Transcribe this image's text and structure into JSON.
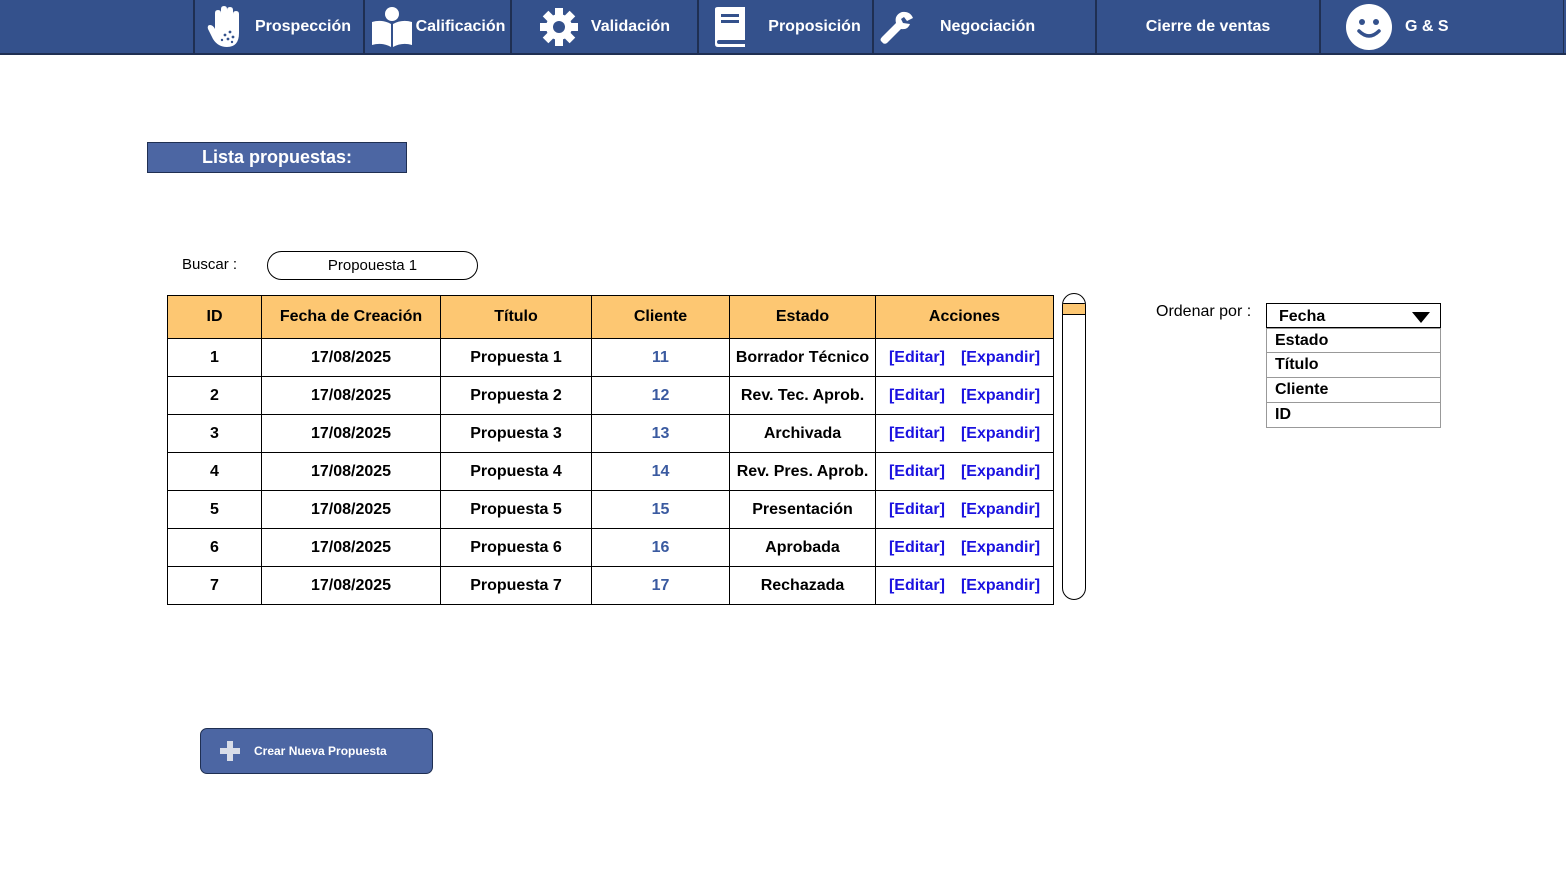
{
  "nav": {
    "items": [
      {
        "label": "Prospección",
        "icon": "hand-icon"
      },
      {
        "label": "Calificación",
        "icon": "book-person-icon"
      },
      {
        "label": "Validación",
        "icon": "gear-icon"
      },
      {
        "label": "Proposición",
        "icon": "book-icon"
      },
      {
        "label": "Negociación",
        "icon": "wrench-icon"
      },
      {
        "label": "Cierre de ventas",
        "icon": ""
      }
    ],
    "profile": {
      "label": "G & S",
      "icon": "smiley-face-icon"
    }
  },
  "page": {
    "title": "Lista propuestas:"
  },
  "search": {
    "label": "Buscar :",
    "value": "Propouesta 1"
  },
  "table": {
    "headers": [
      "ID",
      "Fecha de Creación",
      "Título",
      "Cliente",
      "Estado",
      "Acciones"
    ],
    "action_edit": "[Editar]",
    "action_expand": "[Expandir]",
    "rows": [
      {
        "id": "1",
        "date": "17/08/2025",
        "title": "Propuesta 1",
        "client": "11",
        "status": "Borrador Técnico"
      },
      {
        "id": "2",
        "date": "17/08/2025",
        "title": "Propuesta 2",
        "client": "12",
        "status": "Rev. Tec. Aprob."
      },
      {
        "id": "3",
        "date": "17/08/2025",
        "title": "Propuesta 3",
        "client": "13",
        "status": "Archivada"
      },
      {
        "id": "4",
        "date": "17/08/2025",
        "title": "Propuesta 4",
        "client": "14",
        "status": "Rev. Pres. Aprob."
      },
      {
        "id": "5",
        "date": "17/08/2025",
        "title": "Propuesta 5",
        "client": "15",
        "status": "Presentación"
      },
      {
        "id": "6",
        "date": "17/08/2025",
        "title": "Propuesta 6",
        "client": "16",
        "status": "Aprobada"
      },
      {
        "id": "7",
        "date": "17/08/2025",
        "title": "Propuesta 7",
        "client": "17",
        "status": "Rechazada"
      }
    ]
  },
  "sort": {
    "label": "Ordenar por :",
    "selected": "Fecha",
    "options": [
      "Estado",
      "Título",
      "Cliente",
      "ID"
    ]
  },
  "create_button": {
    "label": "Crear Nueva Propuesta",
    "icon": "plus-icon"
  },
  "colors": {
    "nav_bg": "#34518c",
    "title_bg": "#4c66a3",
    "table_header_bg": "#fdc772",
    "link": "#1b12e0",
    "client_text": "#3a5aa0"
  }
}
